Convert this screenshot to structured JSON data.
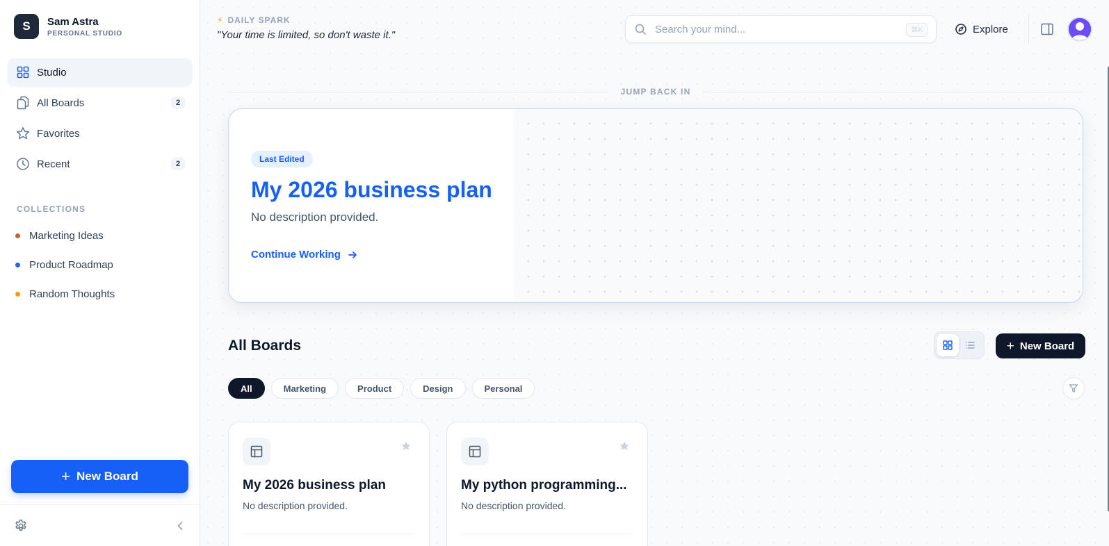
{
  "brand": {
    "initial": "S",
    "name": "Sam Astra",
    "subtitle": "PERSONAL STUDIO"
  },
  "nav": [
    {
      "label": "Studio",
      "icon": "grid-icon",
      "count": null,
      "active": true
    },
    {
      "label": "All Boards",
      "icon": "copy-icon",
      "count": "2",
      "active": false
    },
    {
      "label": "Favorites",
      "icon": "star-icon",
      "count": null,
      "active": false
    },
    {
      "label": "Recent",
      "icon": "clock-icon",
      "count": "2",
      "active": false
    }
  ],
  "collections": {
    "title": "COLLECTIONS",
    "items": [
      {
        "label": "Marketing Ideas",
        "color": "#c2653a"
      },
      {
        "label": "Product Roadmap",
        "color": "#2563eb"
      },
      {
        "label": "Random Thoughts",
        "color": "#f59e0b"
      }
    ]
  },
  "sidebar_new_board": "New Board",
  "spark": {
    "title": "DAILY SPARK",
    "quote": "\"Your time is limited, so don't waste it.\""
  },
  "search": {
    "placeholder": "Search your mind...",
    "value": "",
    "shortcut": "⌘K"
  },
  "explore": "Explore",
  "jump_back": {
    "label": "JUMP BACK IN",
    "badge": "Last Edited",
    "title": "My 2026 business plan",
    "description": "No description provided.",
    "cta": "Continue Working"
  },
  "boards_section": {
    "title": "All Boards",
    "new_board": "New Board",
    "filters": [
      "All",
      "Marketing",
      "Product",
      "Design",
      "Personal"
    ],
    "active_filter": "All",
    "cards": [
      {
        "title": "My 2026 business plan",
        "description": "No description provided."
      },
      {
        "title": "My python programming...",
        "description": "No description provided."
      }
    ]
  },
  "colors": {
    "accent": "#1660f8",
    "dark": "#0f172a",
    "sticky": "#fefbe3"
  }
}
